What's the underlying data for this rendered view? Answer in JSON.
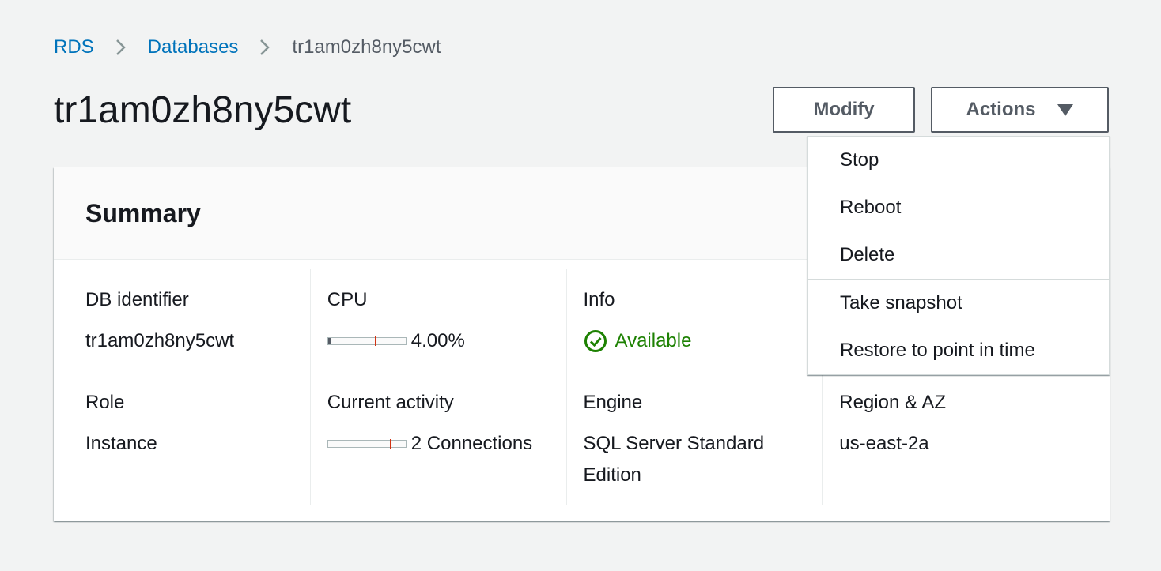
{
  "breadcrumb": {
    "items": [
      "RDS",
      "Databases"
    ],
    "current": "tr1am0zh8ny5cwt"
  },
  "page": {
    "title": "tr1am0zh8ny5cwt"
  },
  "buttons": {
    "modify": "Modify",
    "actions": "Actions"
  },
  "actions_menu": {
    "items": [
      "Stop",
      "Reboot",
      "Delete",
      "Take snapshot",
      "Restore to point in time"
    ]
  },
  "summary": {
    "title": "Summary",
    "db_identifier": {
      "label": "DB identifier",
      "value": "tr1am0zh8ny5cwt"
    },
    "role": {
      "label": "Role",
      "value": "Instance"
    },
    "cpu": {
      "label": "CPU",
      "value": "4.00%",
      "fill_fraction": 0.04,
      "threshold_fraction": 0.6
    },
    "current_activity": {
      "label": "Current activity",
      "value": "2 Connections",
      "fill_fraction": 0.0,
      "threshold_fraction": 0.8
    },
    "info": {
      "label": "Info",
      "value": "Available"
    },
    "engine": {
      "label": "Engine",
      "value": "SQL Server Standard Edition"
    },
    "region": {
      "label": "Region & AZ",
      "value": "us-east-2a"
    }
  },
  "colors": {
    "link": "#0073bb",
    "success": "#1d8102",
    "text": "#16191f",
    "background": "#f2f3f3",
    "threshold": "#d13212"
  },
  "icons": {
    "breadcrumb_separator": "chevron-right-icon",
    "actions_caret": "caret-down-icon",
    "status": "check-circle-icon"
  }
}
